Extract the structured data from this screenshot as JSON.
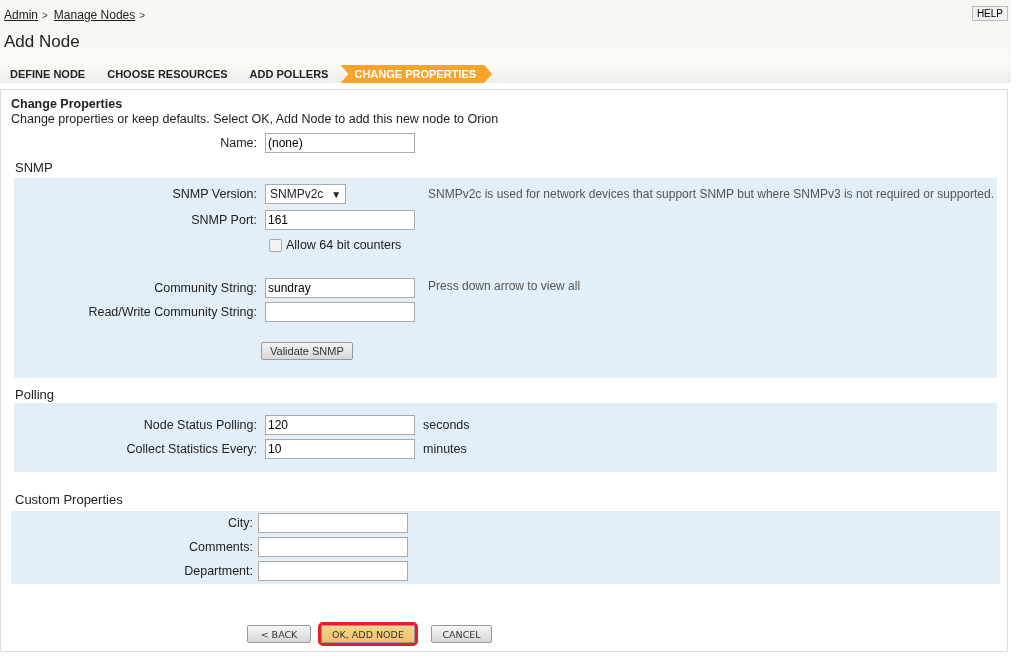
{
  "breadcrumb": {
    "links": [
      "Admin",
      "Manage Nodes"
    ],
    "separator": ">"
  },
  "help_button": "HELP",
  "title": "Add Node",
  "steps": [
    {
      "label": "DEFINE NODE",
      "selected": false
    },
    {
      "label": "CHOOSE RESOURCES",
      "selected": false
    },
    {
      "label": "ADD POLLERS",
      "selected": false
    },
    {
      "label": "CHANGE PROPERTIES",
      "selected": true
    }
  ],
  "panel": {
    "title": "Change Properties",
    "description": "Change properties or keep defaults. Select OK, Add Node to add this new node to Orion"
  },
  "name_field": {
    "label": "Name:",
    "value": "(none)"
  },
  "sections": [
    {
      "title": "SNMP",
      "rows": [
        {
          "kind": "select",
          "label": "SNMP Version:",
          "value": "SNMPv2c",
          "caret": "▼",
          "hint": "SNMPv2c is used for network devices that support SNMP but where SNMPv3 is not required or supported."
        },
        {
          "kind": "text",
          "label": "SNMP Port:",
          "value": "161"
        },
        {
          "kind": "checkbox",
          "label": "Allow 64 bit counters",
          "checked": false
        },
        {
          "kind": "text",
          "label": "Community String:",
          "value": "sundray",
          "hint": "Press down arrow to view all"
        },
        {
          "kind": "text",
          "label": "Read/Write Community String:"
        },
        {
          "kind": "button",
          "label": "Validate SNMP"
        }
      ]
    },
    {
      "title": "Polling",
      "rows": [
        {
          "kind": "text",
          "label": "Node Status Polling:",
          "value": "120",
          "unit": "seconds"
        },
        {
          "kind": "text",
          "label": "Collect Statistics Every:",
          "value": "10",
          "unit": "minutes"
        }
      ]
    },
    {
      "title": "Custom Properties",
      "rows": [
        {
          "kind": "text",
          "label": "City:"
        },
        {
          "kind": "text",
          "label": "Comments:"
        },
        {
          "kind": "text",
          "label": "Department:"
        }
      ]
    }
  ],
  "buttons": [
    {
      "label": "< BACK",
      "highlighted": false
    },
    {
      "label": "OK, ADD NODE",
      "highlighted": true
    },
    {
      "label": "CANCEL",
      "highlighted": false
    }
  ]
}
